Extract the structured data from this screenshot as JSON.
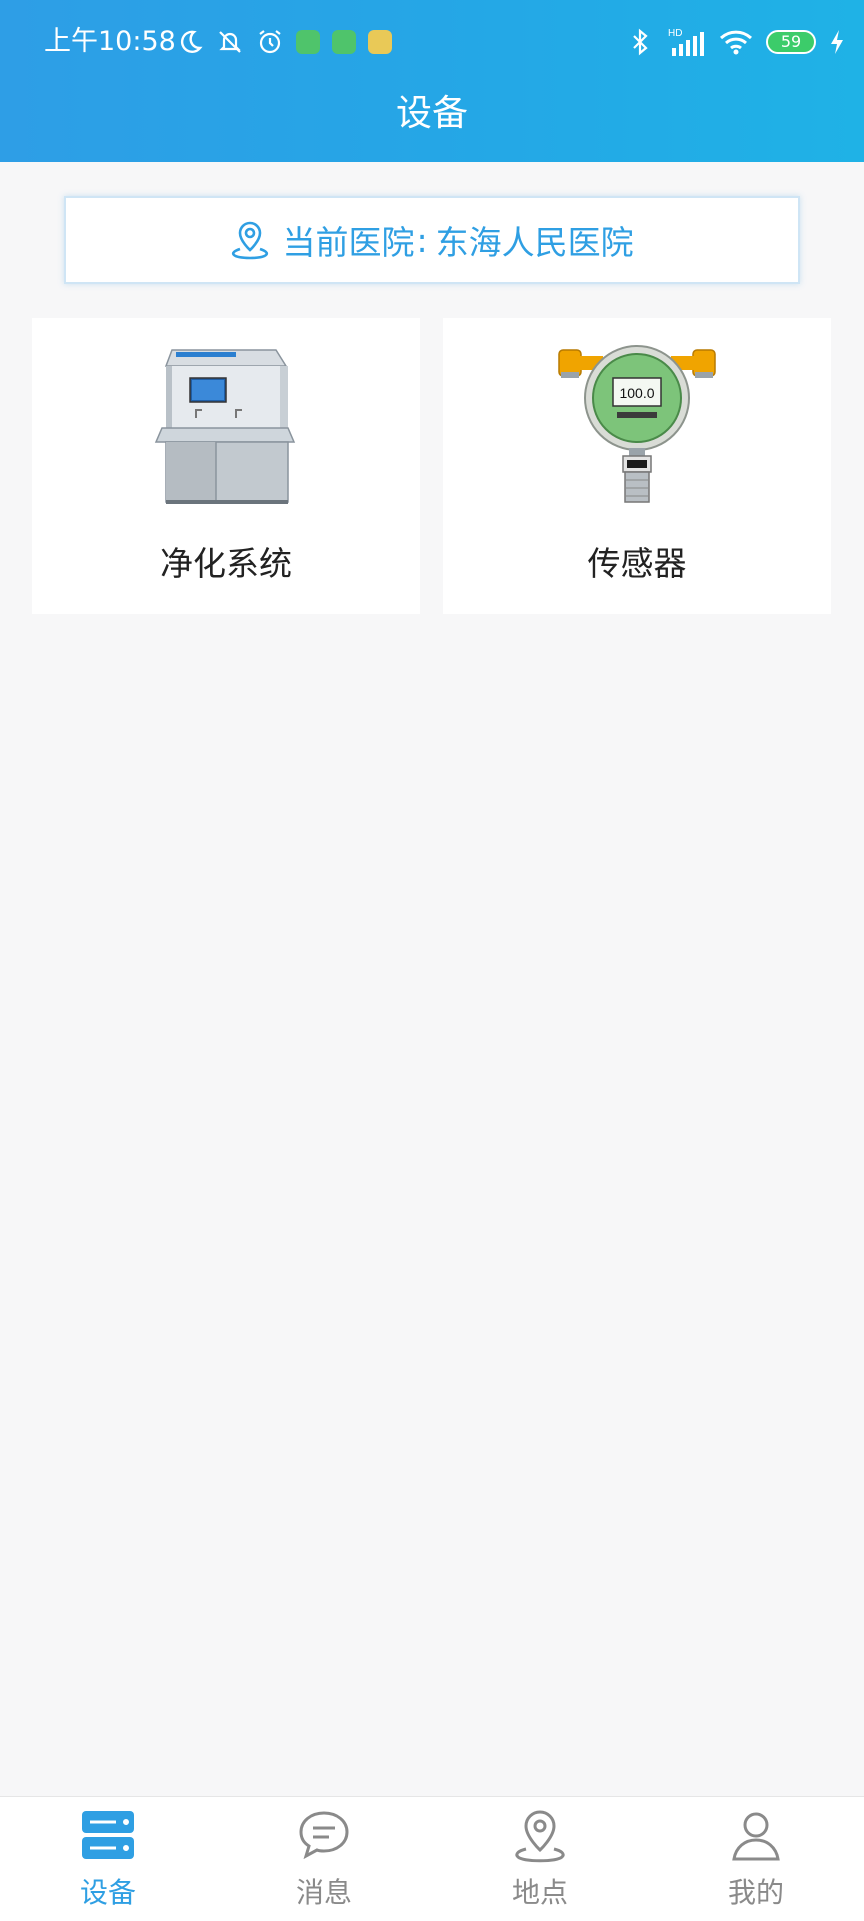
{
  "status_bar": {
    "time": "上午10:58",
    "network": "HD",
    "battery": "59"
  },
  "header": {
    "title": "设备"
  },
  "hospital": {
    "label": "当前医院",
    "colon": ":",
    "name": "东海人民医院"
  },
  "devices": [
    {
      "label": "净化系统",
      "icon": "purification-cabinet-image"
    },
    {
      "label": "传感器",
      "icon": "gas-sensor-image",
      "display_value": "100.0"
    }
  ],
  "nav": {
    "items": [
      {
        "label": "设备",
        "icon": "device-icon",
        "active": true
      },
      {
        "label": "消息",
        "icon": "message-icon",
        "active": false
      },
      {
        "label": "地点",
        "icon": "location-icon",
        "active": false
      },
      {
        "label": "我的",
        "icon": "profile-icon",
        "active": false
      }
    ]
  },
  "colors": {
    "accent": "#2f9fe3",
    "header_start": "#2e9ee6",
    "header_end": "#1fb2e6",
    "background": "#f7f7f8",
    "inactive": "#8a8a8a"
  }
}
